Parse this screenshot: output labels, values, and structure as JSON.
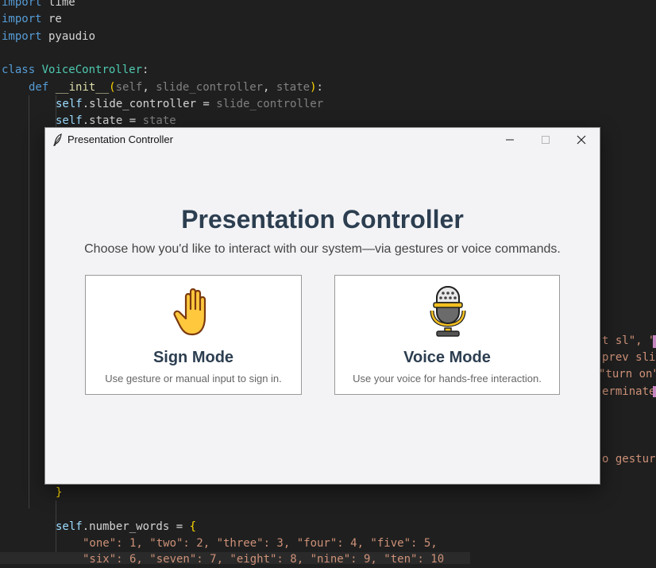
{
  "editor": {
    "lines": [
      [
        "import",
        " time"
      ],
      [
        "import",
        " re"
      ],
      [
        "import",
        " pyaudio"
      ],
      [
        "class",
        " VoiceController",
        ":"
      ],
      [
        "def",
        "__init__",
        "self",
        "slide_controller",
        "state"
      ],
      [
        "self.slide_controller = slide_controller"
      ],
      [
        "self.state = state"
      ]
    ],
    "line_import_time_kw": "import",
    "line_import_time_mod": " time",
    "line_import_re_kw": "import",
    "line_import_re_mod": " re",
    "line_import_pyaudio_kw": "import",
    "line_import_pyaudio_mod": " pyaudio",
    "class_kw": "class",
    "class_name": "VoiceController",
    "class_colon": ":",
    "def_kw": "def",
    "def_name": "__init__",
    "def_param_self": "self",
    "def_param_sc": "slide_controller",
    "def_param_state": "state",
    "assign1_self": "self",
    "assign1_attr": ".slide_controller = ",
    "assign1_val": "slide_controller",
    "assign2_self": "self",
    "assign2_attr": ".state = ",
    "assign2_val": "state",
    "right_frag1_a": "t sl\", \"f",
    "right_frag2": "prev slic",
    "right_frag3": "\"turn on\"",
    "right_frag4_a": "erminate\"",
    "right_frag4_b": "]",
    "right_frag5": "o gesture",
    "close_brace": "}",
    "number_words_self": "self",
    "number_words_attr": ".number_words = ",
    "number_words_brace": "{",
    "nw_line1": "\"one\": 1, \"two\": 2, \"three\": 3, \"four\": 4, \"five\": 5,",
    "nw_line2": "\"six\": 6, \"seven\": 7, \"eight\": 8, \"nine\": 9, \"ten\": 10"
  },
  "window": {
    "title": "Presentation Controller",
    "heading": "Presentation Controller",
    "subheading": "Choose how you'd like to interact with our system—via gestures or voice commands.",
    "modes": [
      {
        "title": "Sign Mode",
        "description": "Use gesture or manual input to sign in.",
        "icon": "raised-hand-icon"
      },
      {
        "title": "Voice Mode",
        "description": "Use your voice for hands-free interaction.",
        "icon": "microphone-icon"
      }
    ]
  },
  "colors": {
    "editor_bg": "#1f1f1f",
    "keyword": "#569cd6",
    "class_name": "#4ec9b0",
    "function": "#dcdcaa",
    "string": "#ce9178",
    "heading": "#2c3e50",
    "window_bg": "#f3f3f6"
  }
}
